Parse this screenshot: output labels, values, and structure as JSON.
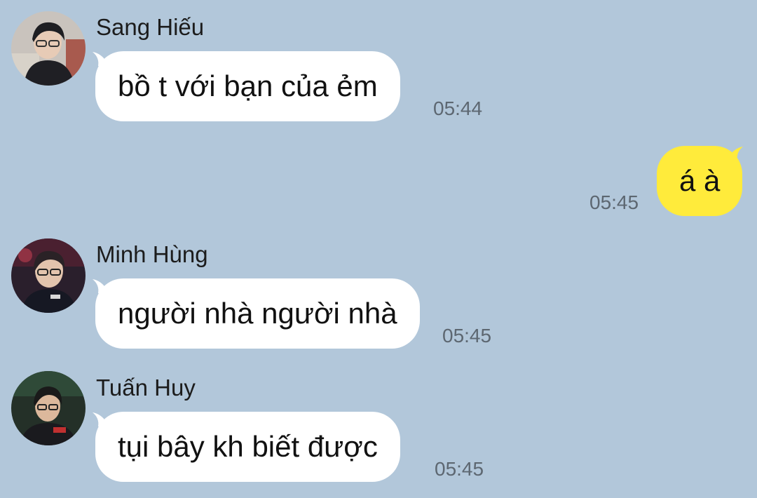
{
  "chat": {
    "messages": [
      {
        "sender": "Sang Hiếu",
        "text": "bồ t với bạn của ẻm",
        "time": "05:44",
        "direction": "incoming"
      },
      {
        "sender": "",
        "text": "á à",
        "time": "05:45",
        "direction": "outgoing"
      },
      {
        "sender": "Minh Hùng",
        "text": "người nhà người nhà",
        "time": "05:45",
        "direction": "incoming"
      },
      {
        "sender": "Tuấn Huy",
        "text": "tụi bây kh biết được",
        "time": "05:45",
        "direction": "incoming"
      }
    ]
  },
  "colors": {
    "background": "#b2c7da",
    "incoming_bubble": "#ffffff",
    "outgoing_bubble": "#ffeb3b",
    "timestamp": "#5d6771"
  }
}
